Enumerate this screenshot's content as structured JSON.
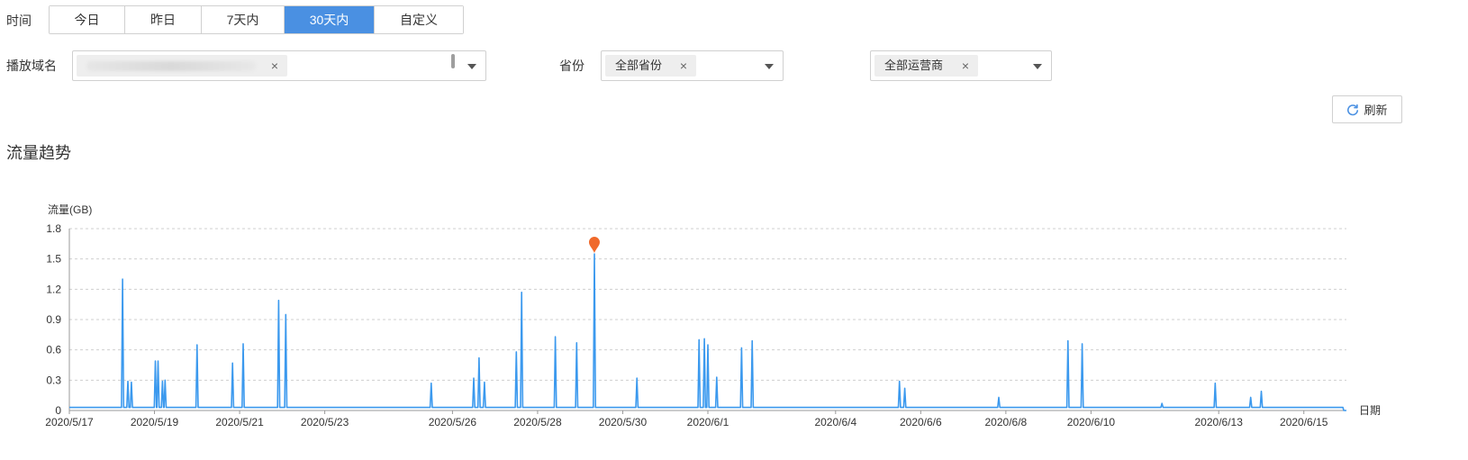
{
  "filters": {
    "time": {
      "label": "时间",
      "options": [
        "今日",
        "昨日",
        "7天内",
        "30天内",
        "自定义"
      ],
      "selected_index": 3
    },
    "domain": {
      "label": "播放域名"
    },
    "province": {
      "label": "省份",
      "tag": "全部省份"
    },
    "isp": {
      "tag": "全部运营商"
    },
    "remove_glyph": "×"
  },
  "refresh": {
    "label": "刷新"
  },
  "section": {
    "title": "流量趋势"
  },
  "colors": {
    "accent": "#4a90e2",
    "line": "#3b99ee",
    "marker": "#f0692b"
  },
  "chart_data": {
    "type": "line",
    "title": "",
    "ylabel": "流量(GB)",
    "xlabel": "日期",
    "ylim": [
      0,
      1.8
    ],
    "yticks": [
      0,
      0.3,
      0.6,
      0.9,
      1.2,
      1.5,
      1.8
    ],
    "ytick_labels": [
      "0",
      "0.3",
      "0.6",
      "0.9",
      "1.2",
      "1.5",
      "1.8"
    ],
    "xlim": [
      "2020-05-17",
      "2020-06-16"
    ],
    "xticks": [
      "2020-05-17",
      "2020-05-19",
      "2020-05-21",
      "2020-05-23",
      "2020-05-26",
      "2020-05-28",
      "2020-05-30",
      "2020-06-01",
      "2020-06-04",
      "2020-06-06",
      "2020-06-08",
      "2020-06-10",
      "2020-06-13",
      "2020-06-15"
    ],
    "xtick_labels": [
      "2020/5/17",
      "2020/5/19",
      "2020/5/21",
      "2020/5/23",
      "2020/5/26",
      "2020/5/28",
      "2020/5/30",
      "2020/6/1",
      "2020/6/4",
      "2020/6/6",
      "2020/6/8",
      "2020/6/10",
      "2020/6/13",
      "2020/6/15"
    ],
    "grid": true,
    "baseline": 0.03,
    "series": [
      {
        "spikes": [
          [
            "2020-05-18 06:00",
            1.3
          ],
          [
            "2020-05-18 09:00",
            0.29
          ],
          [
            "2020-05-18 11:00",
            0.28
          ],
          [
            "2020-05-19 00:30",
            0.49
          ],
          [
            "2020-05-19 02:00",
            0.49
          ],
          [
            "2020-05-19 04:30",
            0.29
          ],
          [
            "2020-05-19 06:00",
            0.3
          ],
          [
            "2020-05-20 00:00",
            0.65
          ],
          [
            "2020-05-20 20:00",
            0.47
          ],
          [
            "2020-05-21 02:00",
            0.66
          ],
          [
            "2020-05-21 22:00",
            1.09
          ],
          [
            "2020-05-22 02:00",
            0.95
          ],
          [
            "2020-05-25 12:00",
            0.27
          ],
          [
            "2020-05-26 12:00",
            0.32
          ],
          [
            "2020-05-26 15:00",
            0.52
          ],
          [
            "2020-05-26 18:00",
            0.28
          ],
          [
            "2020-05-27 12:00",
            0.58
          ],
          [
            "2020-05-27 15:00",
            1.17
          ],
          [
            "2020-05-28 10:00",
            0.73
          ],
          [
            "2020-05-28 22:00",
            0.67
          ],
          [
            "2020-05-29 08:00",
            1.55
          ],
          [
            "2020-05-30 08:00",
            0.32
          ],
          [
            "2020-05-31 19:00",
            0.7
          ],
          [
            "2020-05-31 22:00",
            0.71
          ],
          [
            "2020-06-01 00:00",
            0.65
          ],
          [
            "2020-06-01 05:00",
            0.33
          ],
          [
            "2020-06-01 19:00",
            0.62
          ],
          [
            "2020-06-02 01:00",
            0.69
          ],
          [
            "2020-06-05 12:00",
            0.29
          ],
          [
            "2020-06-05 15:00",
            0.22
          ],
          [
            "2020-06-07 20:00",
            0.13
          ],
          [
            "2020-06-09 11:00",
            0.69
          ],
          [
            "2020-06-09 19:00",
            0.66
          ],
          [
            "2020-06-11 16:00",
            0.07
          ],
          [
            "2020-06-12 22:00",
            0.27
          ],
          [
            "2020-06-13 18:00",
            0.13
          ],
          [
            "2020-06-14 00:00",
            0.19
          ]
        ]
      }
    ],
    "max_point": [
      "2020-05-29 08:00",
      1.55
    ]
  }
}
